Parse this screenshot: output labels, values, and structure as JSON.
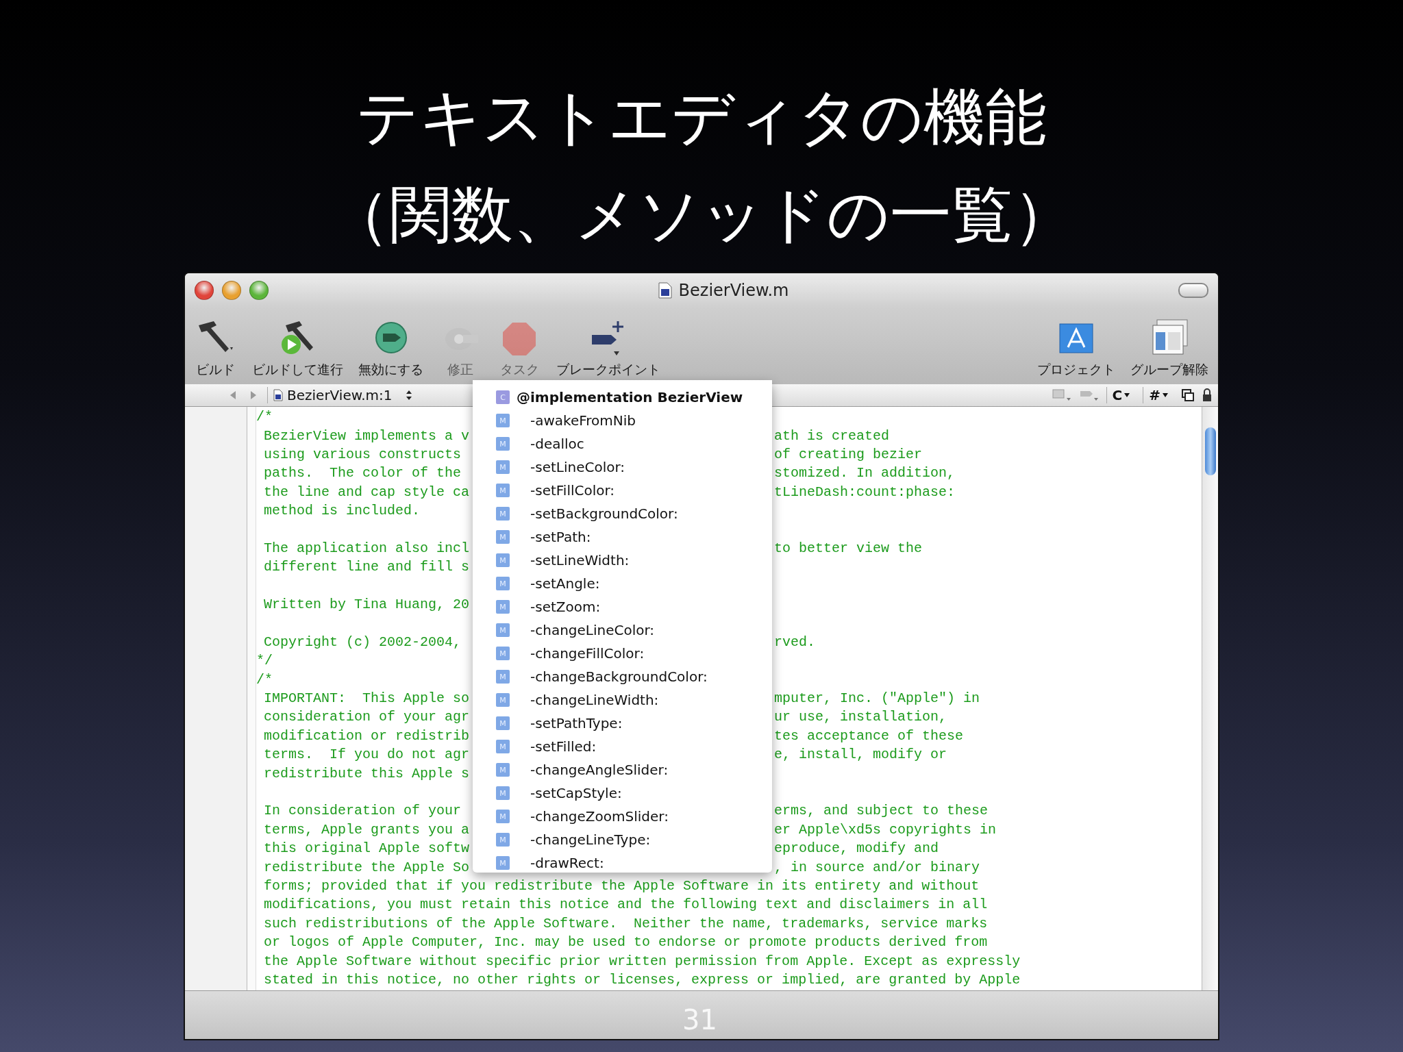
{
  "slide": {
    "title_lines": [
      "テキストエディタの機能",
      "（関数、メソッドの一覧）"
    ],
    "page_number": "31"
  },
  "window": {
    "title": "BezierView.m"
  },
  "toolbar": {
    "left": [
      {
        "label": "ビルド",
        "disabled": false
      },
      {
        "label": "ビルドして進行",
        "disabled": false
      },
      {
        "label": "無効にする",
        "disabled": false
      },
      {
        "label": "修正",
        "disabled": true
      },
      {
        "label": "タスク",
        "disabled": true
      },
      {
        "label": "ブレークポイント",
        "disabled": false
      }
    ],
    "right": [
      {
        "label": "プロジェクト",
        "disabled": false
      },
      {
        "label": "グループ解除",
        "disabled": false
      }
    ]
  },
  "nav_bar": {
    "file": "BezierView.m:1",
    "menus": [
      "C",
      "#"
    ]
  },
  "editor": {
    "lines": [
      {
        "kind": "flush",
        "left": "/*"
      },
      {
        "kind": "indented",
        "left": "BezierView implements a v",
        "right": "ath is created"
      },
      {
        "kind": "indented",
        "left": "using various constructs",
        "right": "of creating bezier"
      },
      {
        "kind": "indented",
        "left": "paths.  The color of the",
        "right": "stomized. In addition,"
      },
      {
        "kind": "indented",
        "left": "the line and cap style ca",
        "right": "tLineDash:count:phase:"
      },
      {
        "kind": "indented",
        "left": "method is included."
      },
      {
        "kind": "blank"
      },
      {
        "kind": "indented",
        "left": "The application also incl",
        "right": "to better view the"
      },
      {
        "kind": "indented",
        "left": "different line and fill s"
      },
      {
        "kind": "blank"
      },
      {
        "kind": "indented",
        "left": "Written by Tina Huang, 20"
      },
      {
        "kind": "blank"
      },
      {
        "kind": "indented",
        "left": "Copyright (c) 2002-2004,",
        "right": "rved."
      },
      {
        "kind": "flush",
        "left": "*/"
      },
      {
        "kind": "flush",
        "left": "/*"
      },
      {
        "kind": "indented",
        "left": "IMPORTANT:  This Apple so",
        "right": "mputer, Inc. (\"Apple\") in"
      },
      {
        "kind": "indented",
        "left": "consideration of your agr",
        "right": "ur use, installation,"
      },
      {
        "kind": "indented",
        "left": "modification or redistrib",
        "right": "tes acceptance of these"
      },
      {
        "kind": "indented",
        "left": "terms.  If you do not agr",
        "right": "e, install, modify or"
      },
      {
        "kind": "indented",
        "left": "redistribute this Apple s"
      },
      {
        "kind": "blank"
      },
      {
        "kind": "indented",
        "left": "In consideration of your",
        "right": "erms, and subject to these"
      },
      {
        "kind": "indented",
        "left": "terms, Apple grants you a",
        "right": "er Apple\\xd5s copyrights in"
      },
      {
        "kind": "indented",
        "left": "this original Apple softw",
        "right": "eproduce, modify and"
      },
      {
        "kind": "indented",
        "left": "redistribute the Apple So",
        "right": ", in source and/or binary"
      },
      {
        "kind": "indented",
        "left": "forms; provided that if you redistribute the Apple Software in its entirety and without"
      },
      {
        "kind": "indented",
        "left": "modifications, you must retain this notice and the following text and disclaimers in all"
      },
      {
        "kind": "indented",
        "left": "such redistributions of the Apple Software.  Neither the name, trademarks, service marks"
      },
      {
        "kind": "indented",
        "left": "or logos of Apple Computer, Inc. may be used to endorse or promote products derived from"
      },
      {
        "kind": "indented",
        "left": "the Apple Software without specific prior written permission from Apple. Except as expressly"
      },
      {
        "kind": "indented",
        "left": "stated in this notice, no other rights or licenses, express or implied, are granted by Apple"
      }
    ]
  },
  "symbol_popup": {
    "items": [
      {
        "kind": "class",
        "badge": "C",
        "label": "@implementation BezierView"
      },
      {
        "kind": "method",
        "badge": "M",
        "label": "-awakeFromNib"
      },
      {
        "kind": "method",
        "badge": "M",
        "label": "-dealloc"
      },
      {
        "kind": "method",
        "badge": "M",
        "label": "-setLineColor:"
      },
      {
        "kind": "method",
        "badge": "M",
        "label": "-setFillColor:"
      },
      {
        "kind": "method",
        "badge": "M",
        "label": "-setBackgroundColor:"
      },
      {
        "kind": "method",
        "badge": "M",
        "label": "-setPath:"
      },
      {
        "kind": "method",
        "badge": "M",
        "label": "-setLineWidth:"
      },
      {
        "kind": "method",
        "badge": "M",
        "label": "-setAngle:"
      },
      {
        "kind": "method",
        "badge": "M",
        "label": "-setZoom:"
      },
      {
        "kind": "method",
        "badge": "M",
        "label": "-changeLineColor:"
      },
      {
        "kind": "method",
        "badge": "M",
        "label": "-changeFillColor:"
      },
      {
        "kind": "method",
        "badge": "M",
        "label": "-changeBackgroundColor:"
      },
      {
        "kind": "method",
        "badge": "M",
        "label": "-changeLineWidth:"
      },
      {
        "kind": "method",
        "badge": "M",
        "label": "-setPathType:"
      },
      {
        "kind": "method",
        "badge": "M",
        "label": "-setFilled:"
      },
      {
        "kind": "method",
        "badge": "M",
        "label": "-changeAngleSlider:"
      },
      {
        "kind": "method",
        "badge": "M",
        "label": "-setCapStyle:"
      },
      {
        "kind": "method",
        "badge": "M",
        "label": "-changeZoomSlider:"
      },
      {
        "kind": "method",
        "badge": "M",
        "label": "-changeLineType:"
      },
      {
        "kind": "method",
        "badge": "M",
        "label": "-drawRect:"
      }
    ]
  }
}
